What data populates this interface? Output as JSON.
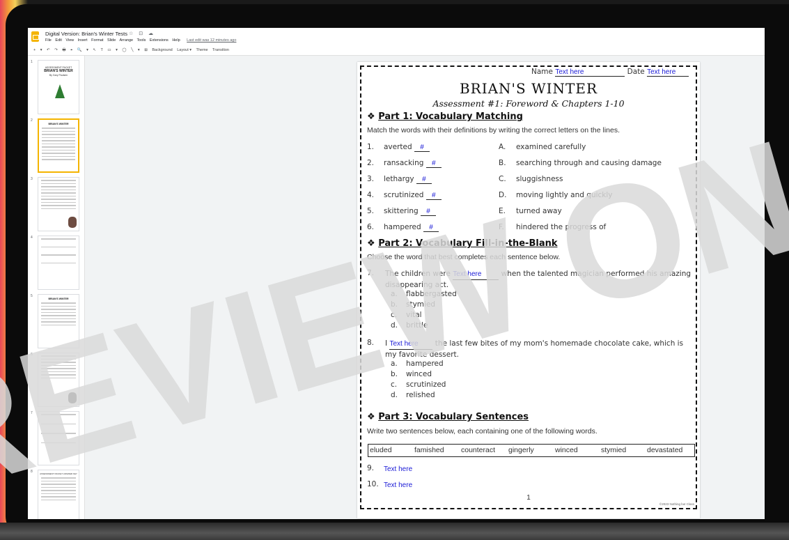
{
  "app": {
    "doc_title": "Digital Version: Brian's Winter Tests",
    "title_icons": "☆ ⊡ ☁",
    "menu": [
      "File",
      "Edit",
      "View",
      "Insert",
      "Format",
      "Slide",
      "Arrange",
      "Tools",
      "Extensions",
      "Help"
    ],
    "last_edit": "Last edit was 12 minutes ago",
    "toolbar": [
      "+",
      "▾",
      "↶",
      "↷",
      "🖶",
      "⌖",
      "🔍",
      "▾",
      "↖",
      "T",
      "▭",
      "▾",
      "◯",
      "╲",
      "▾",
      "⊞",
      "Background",
      "Layout ▾",
      "Theme",
      "Transition"
    ]
  },
  "filmstrip": {
    "slides": [
      {
        "num": "1",
        "t1": "ASSESSMENT PACKET",
        "t2": "BRIAN'S WINTER",
        "t3": "By Gary Paulsen"
      },
      {
        "num": "2",
        "t1": "",
        "t2": "BRIAN'S WINTER",
        "t3": ""
      },
      {
        "num": "3",
        "t1": "",
        "t2": "",
        "t3": ""
      },
      {
        "num": "4",
        "t1": "",
        "t2": "",
        "t3": ""
      },
      {
        "num": "5",
        "t1": "",
        "t2": "BRIAN'S WINTER",
        "t3": ""
      },
      {
        "num": "6",
        "t1": "",
        "t2": "",
        "t3": ""
      },
      {
        "num": "7",
        "t1": "",
        "t2": "",
        "t3": ""
      },
      {
        "num": "8",
        "t1": "ASSESSMENT PACKET ANSWER KEY",
        "t2": "",
        "t3": ""
      }
    ]
  },
  "worksheet": {
    "name_label": "Name",
    "name_value": "Text here",
    "date_label": "Date",
    "date_value": "Text here",
    "title": "BRIAN'S WINTER",
    "subtitle": "Assessment #1: Foreword & Chapters 1-10",
    "part1": {
      "bullet": "❖",
      "heading": "Part 1: Vocabulary Matching",
      "instructions": "Match the words with their definitions by writing the correct letters on the lines.",
      "rows": [
        {
          "num": "1.",
          "word": "averted",
          "answer": "#",
          "letter": "A.",
          "def": "examined carefully"
        },
        {
          "num": "2.",
          "word": "ransacking",
          "answer": "#",
          "letter": "B.",
          "def": "searching through and causing damage"
        },
        {
          "num": "3.",
          "word": "lethargy",
          "answer": "#",
          "letter": "C.",
          "def": "sluggishness"
        },
        {
          "num": "4.",
          "word": "scrutinized",
          "answer": "#",
          "letter": "D.",
          "def": "moving lightly and quickly"
        },
        {
          "num": "5.",
          "word": "skittering",
          "answer": "#",
          "letter": "E.",
          "def": "turned away"
        },
        {
          "num": "6.",
          "word": "hampered",
          "answer": "#",
          "letter": "F.",
          "def": "hindered the progress of"
        }
      ]
    },
    "part2": {
      "bullet": "❖",
      "heading": "Part 2: Vocabulary Fill-in-the-Blank",
      "instructions": "Choose the word that best completes each sentence below.",
      "questions": [
        {
          "num": "7.",
          "before": "The children were",
          "blank": "Text here",
          "after": "when the talented magician performed his amazing disappearing act.",
          "options": [
            {
              "letter": "a.",
              "text": "flabbergasted"
            },
            {
              "letter": "b.",
              "text": "stymied"
            },
            {
              "letter": "c.",
              "text": "vital"
            },
            {
              "letter": "d.",
              "text": "brittle"
            }
          ]
        },
        {
          "num": "8.",
          "before": "I",
          "blank": "Text here",
          "after": "the last few bites of my mom's homemade chocolate cake, which is my favorite dessert.",
          "options": [
            {
              "letter": "a.",
              "text": "hampered"
            },
            {
              "letter": "b.",
              "text": "winced"
            },
            {
              "letter": "c.",
              "text": "scrutinized"
            },
            {
              "letter": "d.",
              "text": "relished"
            }
          ]
        }
      ]
    },
    "part3": {
      "bullet": "❖",
      "heading": "Part 3: Vocabulary Sentences",
      "instructions": "Write two sentences below, each containing one of the following words.",
      "words": [
        "eluded",
        "famished",
        "counteract",
        "gingerly",
        "winced",
        "stymied",
        "devastated"
      ],
      "sentences": [
        {
          "num": "9.",
          "value": "Text here"
        },
        {
          "num": "10.",
          "value": "Text here"
        }
      ]
    },
    "page_number": "1",
    "copyright": "©2023 Nothing but Class"
  },
  "watermark": {
    "text": "PREVIEW ONLY",
    "color": "#d9d9d9"
  }
}
